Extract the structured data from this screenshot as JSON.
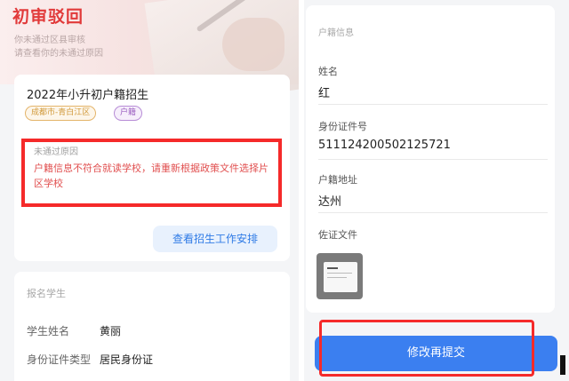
{
  "left": {
    "header": {
      "title": "初审驳回",
      "subtitle1": "你未通过区县审核",
      "subtitle2": "请查看你的未通过原因"
    },
    "program": {
      "title": "2022年小升初户籍招生",
      "tags": [
        "成都市-青白江区",
        "户籍"
      ]
    },
    "rejection": {
      "label": "未通过原因",
      "text": "户籍信息不符合就读学校，请重新根据政策文件选择片区学校"
    },
    "schedule_button": "查看招生工作安排",
    "student": {
      "section_title": "报名学生",
      "name_label": "学生姓名",
      "name_value": "黄丽",
      "id_type_label": "身份证件类型",
      "id_type_value": "居民身份证"
    }
  },
  "right": {
    "section_title": "户籍信息",
    "fields": [
      {
        "label": "姓名",
        "value": "红"
      },
      {
        "label": "身份证件号",
        "value": "511124200502125721"
      },
      {
        "label": "户籍地址",
        "value": "达州"
      },
      {
        "label": "佐证文件",
        "value": ""
      }
    ],
    "submit_button": "修改再提交"
  },
  "colors": {
    "accent_red": "#e13a3a",
    "highlight_red": "#f52a2a",
    "primary_blue": "#3b7ff0",
    "tag_orange": "#d19a3c",
    "tag_purple": "#9b5fc0"
  }
}
